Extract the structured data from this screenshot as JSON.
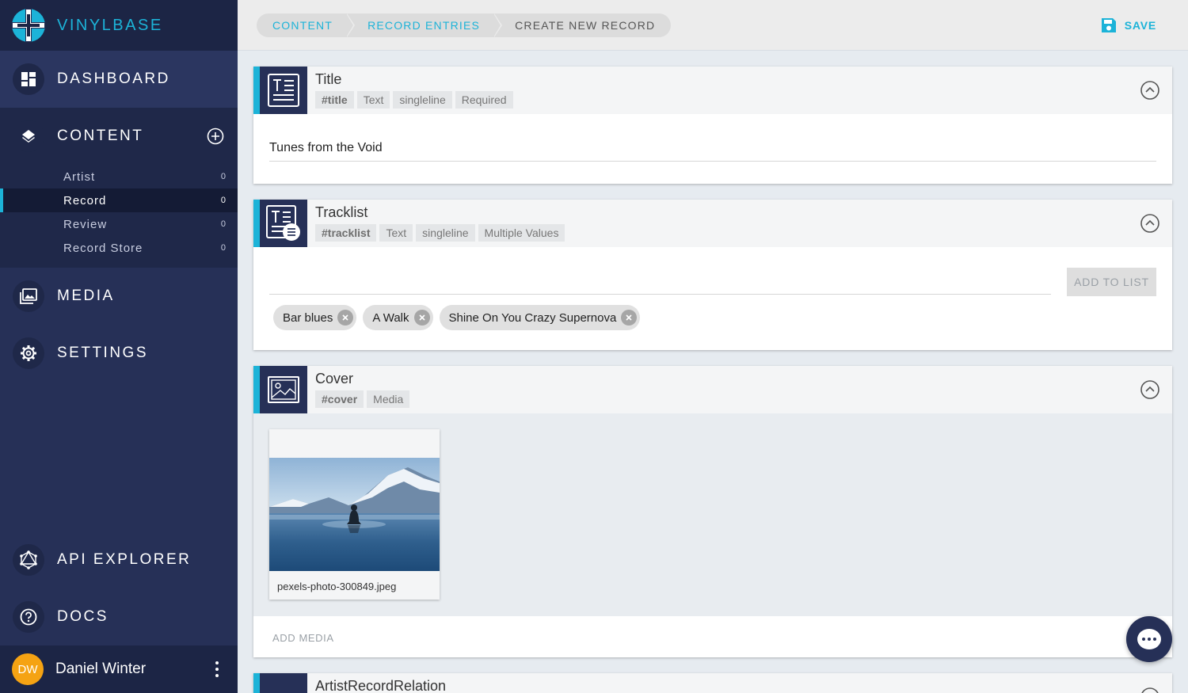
{
  "app": {
    "name": "VINYLBASE"
  },
  "sidebar": {
    "dashboard": "DASHBOARD",
    "content": "CONTENT",
    "content_items": [
      {
        "label": "Artist",
        "count": "0"
      },
      {
        "label": "Record",
        "count": "0"
      },
      {
        "label": "Review",
        "count": "0"
      },
      {
        "label": "Record Store",
        "count": "0"
      }
    ],
    "media": "MEDIA",
    "settings": "SETTINGS",
    "api_explorer": "API EXPLORER",
    "docs": "DOCS",
    "user": {
      "initials": "DW",
      "name": "Daniel Winter"
    },
    "accent_color": "#1cb3d8"
  },
  "topbar": {
    "breadcrumbs": [
      "CONTENT",
      "RECORD ENTRIES",
      "CREATE NEW RECORD"
    ],
    "save_label": "SAVE"
  },
  "fields": {
    "title": {
      "name": "Title",
      "tags": [
        "#title",
        "Text",
        "singleline",
        "Required"
      ],
      "value": "Tunes from the Void"
    },
    "tracklist": {
      "name": "Tracklist",
      "tags": [
        "#tracklist",
        "Text",
        "singleline",
        "Multiple Values"
      ],
      "input_value": "",
      "add_label": "ADD TO LIST",
      "items": [
        "Bar blues",
        "A Walk",
        "Shine On You Crazy Supernova"
      ]
    },
    "cover": {
      "name": "Cover",
      "tags": [
        "#cover",
        "Media"
      ],
      "file_name": "pexels-photo-300849.jpeg",
      "add_label": "ADD MEDIA"
    },
    "relation": {
      "name": "ArtistRecordRelation"
    }
  },
  "icons": {
    "dashboard": "dashboard-icon",
    "content": "layers-icon",
    "media": "photo-library-icon",
    "settings": "gear-icon",
    "api_explorer": "graphql-icon",
    "docs": "help-icon",
    "save": "floppy-disk-icon",
    "collapse": "chevron-up-circle-icon",
    "chat": "chat-bubble-icon"
  }
}
